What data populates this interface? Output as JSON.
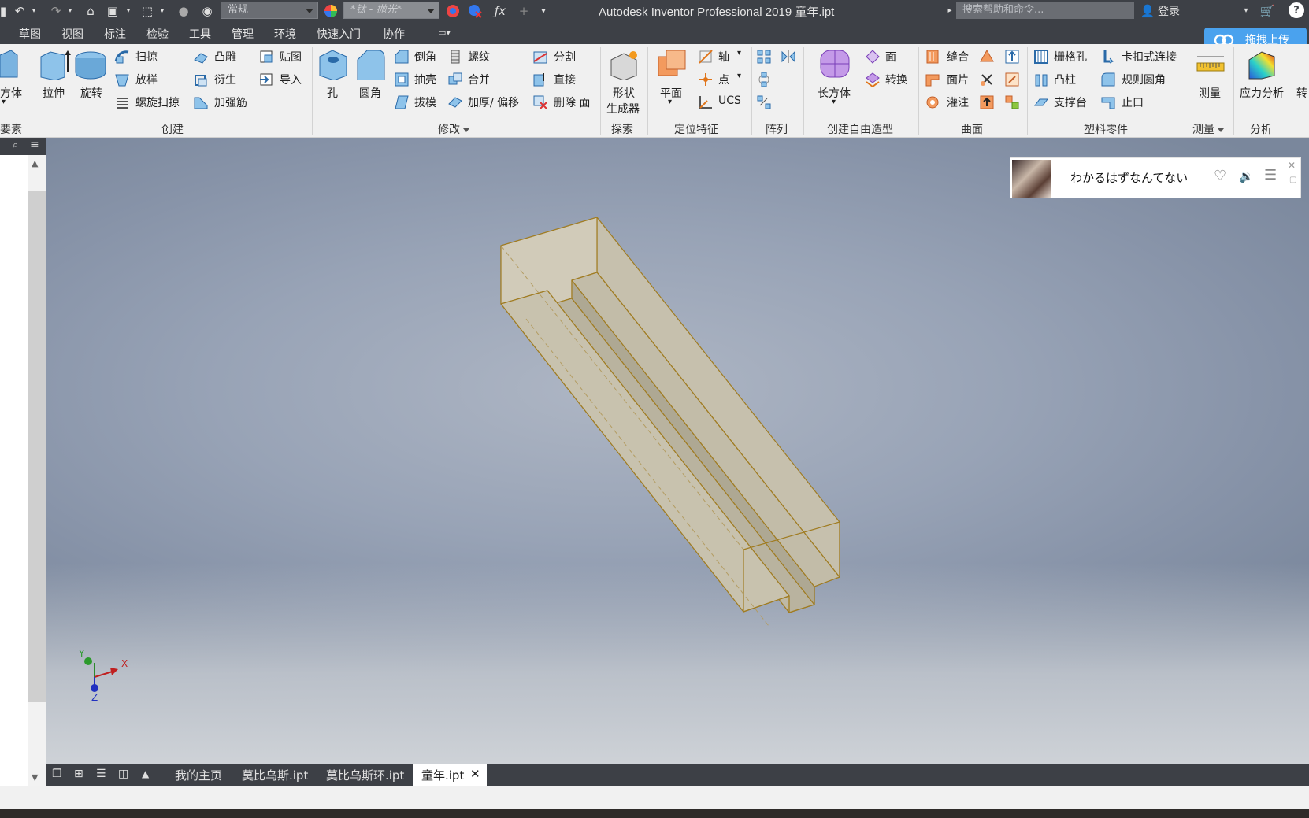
{
  "titlebar": {
    "style_combo": "常规",
    "material_combo": "*钛 - 抛光*",
    "title": "Autodesk Inventor Professional 2019    童年.ipt",
    "search_placeholder": "搜索帮助和命令...",
    "login": "登录"
  },
  "tabs": [
    "草图",
    "视图",
    "标注",
    "检验",
    "工具",
    "管理",
    "环境",
    "快速入门",
    "协作"
  ],
  "upload_button": "拖拽上传",
  "ribbon": {
    "create": {
      "box": "方体",
      "extrude": "拉伸",
      "revolve": "旋转",
      "sweep": "扫掠",
      "loft": "放样",
      "coil": "螺旋扫掠",
      "emboss": "凸雕",
      "derive": "衍生",
      "rib": "加强筋",
      "decal": "贴图",
      "import": "导入",
      "group": "创建"
    },
    "primary_group": "要素",
    "modify": {
      "hole": "孔",
      "fillet": "圆角",
      "chamfer": "倒角",
      "shell": "抽壳",
      "draft": "拔模",
      "thread": "螺纹",
      "combine": "合并",
      "thicken": "加厚/ 偏移",
      "split": "分割",
      "direct": "直接",
      "delete_face": "删除 面",
      "group": "修改"
    },
    "explore": {
      "shape_gen_line1": "形状",
      "shape_gen_line2": "生成器",
      "group": "探索"
    },
    "work": {
      "plane": "平面",
      "axis": "轴",
      "point": "点",
      "ucs": "UCS",
      "group": "定位特征"
    },
    "pattern": {
      "group": "阵列"
    },
    "freeform": {
      "box": "长方体",
      "face": "面",
      "convert": "转换",
      "group": "创建自由造型"
    },
    "surface": {
      "stitch": "缝合",
      "patch": "面片",
      "sculpt": "灌注",
      "group": "曲面"
    },
    "plastic": {
      "grill": "栅格孔",
      "boss": "凸柱",
      "rest": "支撑台",
      "snap": "卡扣式连接",
      "rule_fillet": "规则圆角",
      "lip": "止口",
      "group": "塑料零件"
    },
    "measure": {
      "measure": "测量",
      "group": "测量"
    },
    "analysis": {
      "stress": "应力分析",
      "group": "分析",
      "convert": "转"
    }
  },
  "music": {
    "song": "わかるはずなんてない"
  },
  "triad": {
    "x": "X",
    "y": "Y",
    "z": "Z"
  },
  "doc_tabs": [
    "我的主页",
    "莫比乌斯.ipt",
    "莫比乌斯环.ipt",
    "童年.ipt"
  ],
  "colors": {
    "chrome_dark": "#3d4046",
    "ribbon_bg": "#f0f0f0",
    "accent_blue": "#2c8ae8",
    "part_fill": "#c9c3b1",
    "part_edge": "#9a7a2a"
  }
}
